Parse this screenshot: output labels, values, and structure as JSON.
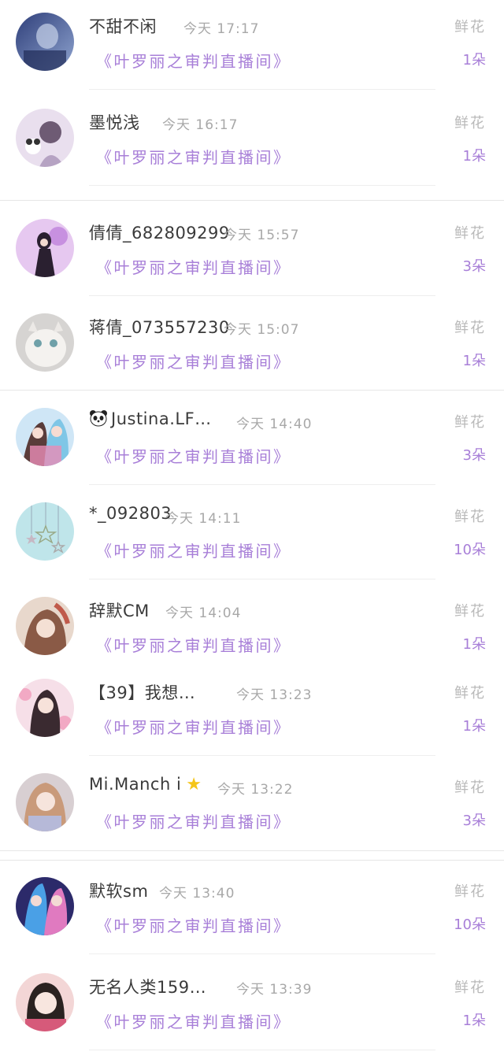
{
  "gift_list": {
    "items": [
      {
        "name": "不甜不闲",
        "time": "今天 17:17",
        "room": "《叶罗丽之审判直播间》",
        "gift_label": "鲜花",
        "count": "1朵"
      },
      {
        "name": "墨悦浅",
        "time": "今天 16:17",
        "room": "《叶罗丽之审判直播间》",
        "gift_label": "鲜花",
        "count": "1朵"
      },
      {
        "name": "倩倩_682809299",
        "time": "今天 15:57",
        "room": "《叶罗丽之审判直播间》",
        "gift_label": "鲜花",
        "count": "3朵"
      },
      {
        "name": "蒋倩_073557230",
        "time": "今天 15:07",
        "room": "《叶罗丽之审判直播间》",
        "gift_label": "鲜花",
        "count": "1朵"
      },
      {
        "name": "Justina.LF…",
        "time": "今天 14:40",
        "room": "《叶罗丽之审判直播间》",
        "gift_label": "鲜花",
        "count": "3朵"
      },
      {
        "name": "*_092803",
        "time": "今天 14:11",
        "room": "《叶罗丽之审判直播间》",
        "gift_label": "鲜花",
        "count": "10朵"
      },
      {
        "name": "辞默CM",
        "time": "今天 14:04",
        "room": "《叶罗丽之审判直播间》",
        "gift_label": "鲜花",
        "count": "1朵"
      },
      {
        "name": "【39】我想…",
        "time": "今天 13:23",
        "room": "《叶罗丽之审判直播间》",
        "gift_label": "鲜花",
        "count": "1朵"
      },
      {
        "name": "Mi.Manch i",
        "time": "今天 13:22",
        "room": "《叶罗丽之审判直播间》",
        "gift_label": "鲜花",
        "count": "3朵"
      },
      {
        "name": "默软sm",
        "time": "今天 13:40",
        "room": "《叶罗丽之审判直播间》",
        "gift_label": "鲜花",
        "count": "10朵"
      },
      {
        "name": "无名人类159…",
        "time": "今天 13:39",
        "room": "《叶罗丽之审判直播间》",
        "gift_label": "鲜花",
        "count": "1朵"
      }
    ]
  },
  "colors": {
    "accent_purple": "#a87fd8",
    "name_text": "#3a3a3a",
    "muted_text": "#a8a8a8"
  },
  "icons": {
    "panda": "panda-icon",
    "star": "star-icon"
  }
}
